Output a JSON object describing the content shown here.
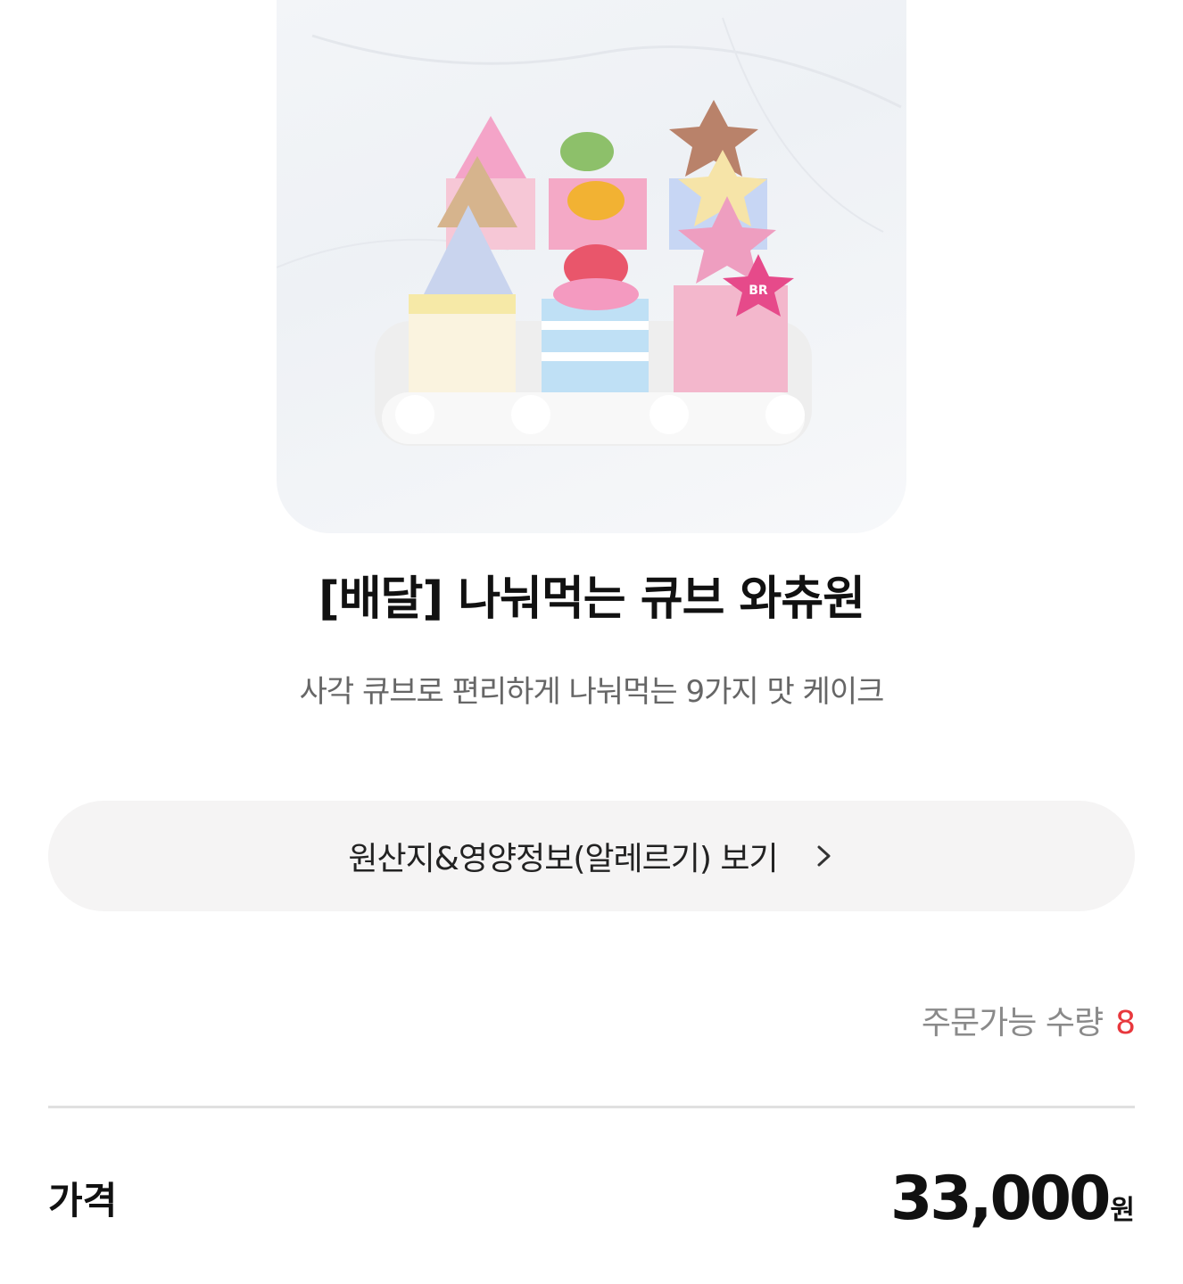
{
  "product": {
    "title": "[배달] 나눠먹는 큐브 와츄원",
    "subtitle": "사각 큐브로 편리하게 나눠먹는 9가지 맛 케이크",
    "image_icon": "cube-cake-image",
    "logo_text": "BR"
  },
  "info_button": {
    "label": "원산지&영양정보(알레르기) 보기",
    "icon": "chevron-right-icon"
  },
  "stock": {
    "label": "주문가능 수량",
    "count": "8"
  },
  "price": {
    "label": "가격",
    "amount": "33,000",
    "unit": "원"
  },
  "colors": {
    "accent_red": "#e8383d",
    "button_bg": "#f5f4f4",
    "divider": "#e0e0e0",
    "muted_text": "#8a8a8a"
  }
}
